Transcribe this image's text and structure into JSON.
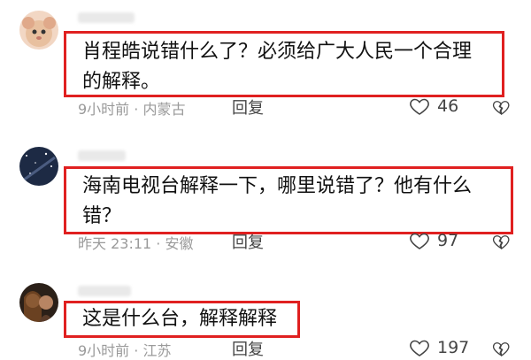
{
  "comments": [
    {
      "text": "肖程皓说错什么了？必须给广大人民一个合理\n的解释。",
      "meta": "9小时前 · 内蒙古",
      "reply_label": "回复",
      "like_count": "46"
    },
    {
      "text": "海南电视台解释一下，哪里说错了？他有什么\n错？",
      "meta": "昨天 23:11 · 安徽",
      "reply_label": "回复",
      "like_count": "97"
    },
    {
      "text": "这是什么台，解释解释",
      "meta": "9小时前 · 江苏",
      "reply_label": "回复",
      "like_count": "197"
    }
  ],
  "icons": {
    "like": "heart-outline-icon",
    "dislike": "broken-heart-icon"
  },
  "colors": {
    "highlight_border": "#e02020",
    "meta_text": "#9a9a9a"
  }
}
